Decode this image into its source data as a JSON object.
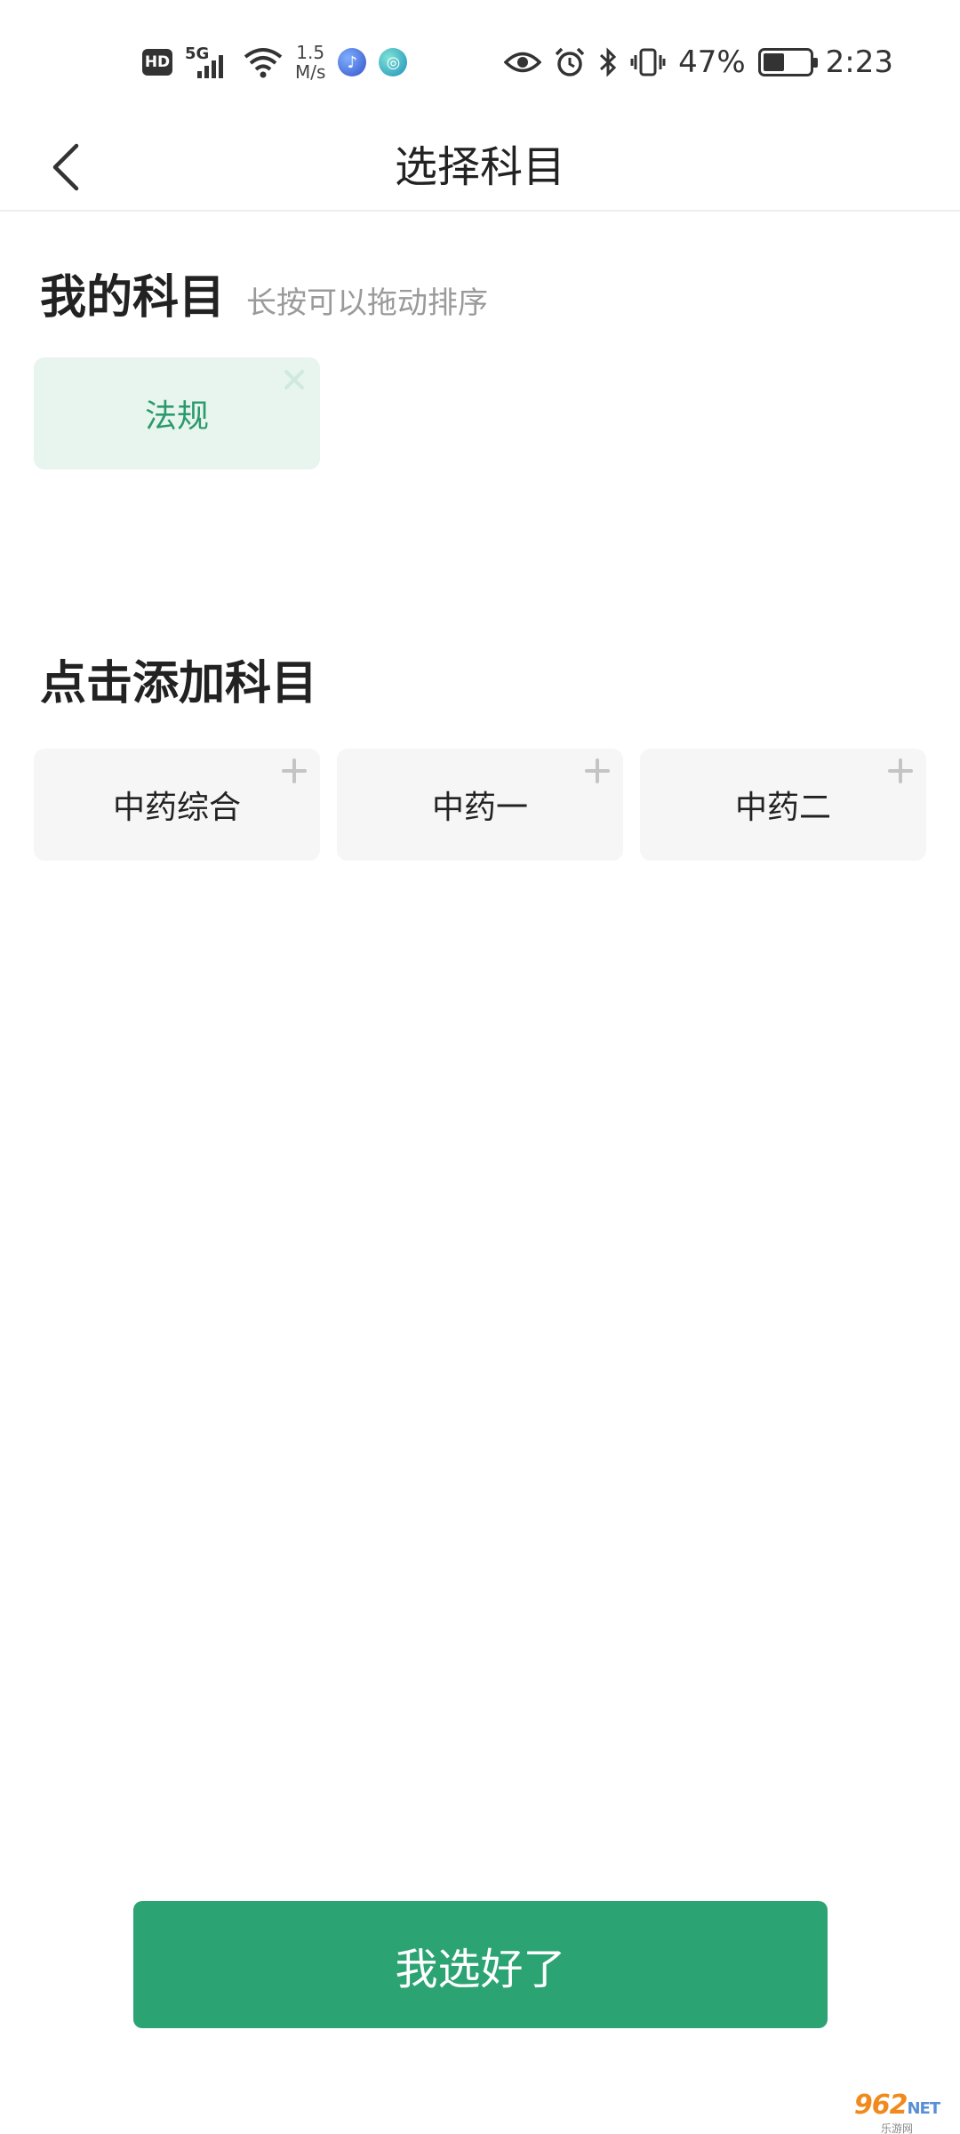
{
  "status_bar": {
    "hd": "HD",
    "network": "5G",
    "speed_value": "1.5",
    "speed_unit": "M/s",
    "battery_percent": "47%",
    "battery_level": 0.47,
    "time": "2:23",
    "icons": [
      "hd-icon",
      "5g-signal-icon",
      "wifi-icon",
      "music-app-icon",
      "mobile-app-icon",
      "eye-icon",
      "alarm-icon",
      "bluetooth-icon",
      "vibrate-icon",
      "battery-icon"
    ]
  },
  "nav": {
    "title": "选择科目",
    "back_icon": "chevron-left-icon"
  },
  "my_subjects": {
    "title": "我的科目",
    "hint": "长按可以拖动排序",
    "items": [
      {
        "label": "法规",
        "action_icon": "remove-x-icon"
      }
    ]
  },
  "add_subjects": {
    "title": "点击添加科目",
    "items": [
      {
        "label": "中药综合",
        "action_icon": "add-plus-icon"
      },
      {
        "label": "中药一",
        "action_icon": "add-plus-icon"
      },
      {
        "label": "中药二",
        "action_icon": "add-plus-icon"
      }
    ]
  },
  "confirm_label": "我选好了",
  "colors": {
    "primary_green": "#2ba373",
    "selected_chip_bg": "#e7f5ee",
    "selected_chip_text": "#2b9a6c",
    "available_chip_bg": "#f6f6f6"
  },
  "watermark": {
    "logo_main": "962",
    "logo_suffix": "NET",
    "subtitle": "乐游网"
  }
}
